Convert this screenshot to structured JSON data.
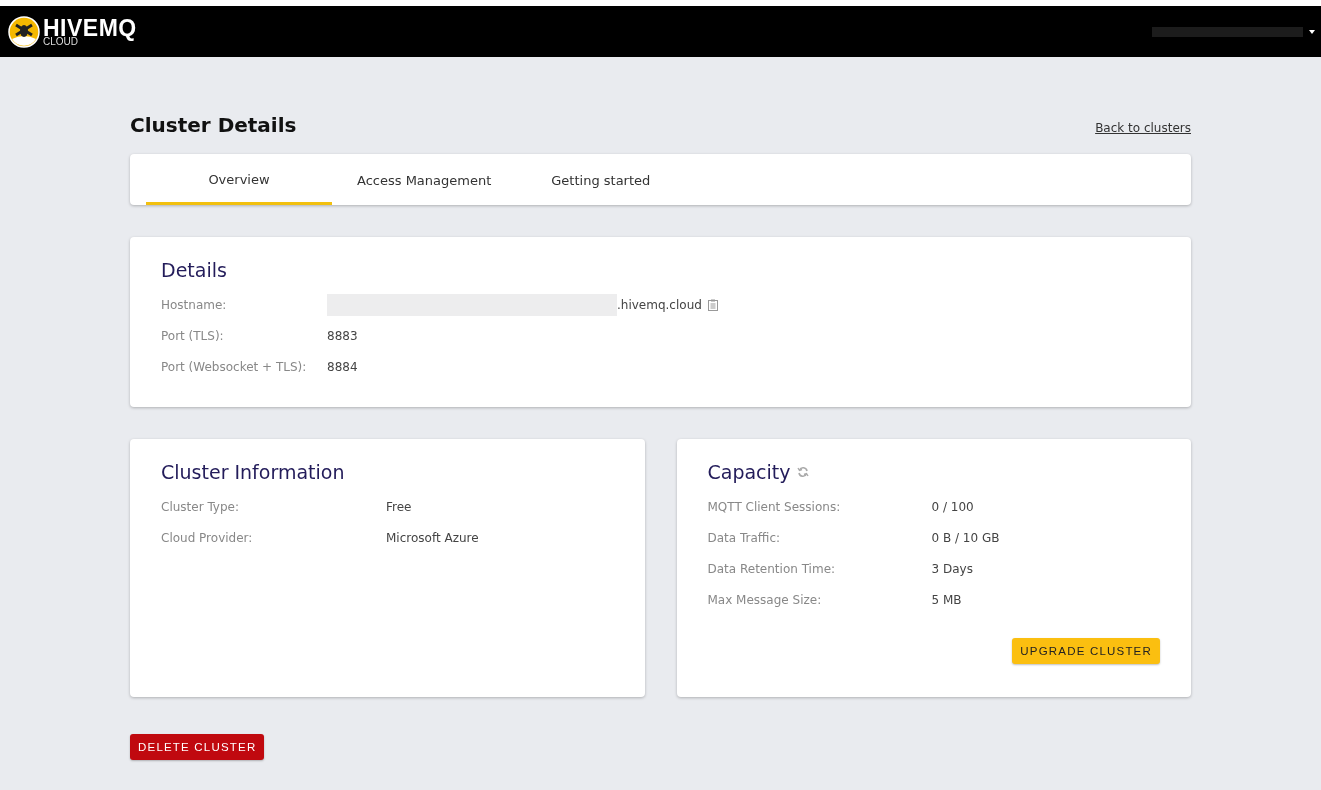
{
  "header": {
    "brand": "HIVEMQ",
    "brand_sub": "CLOUD"
  },
  "page": {
    "title": "Cluster Details",
    "back_link": "Back to clusters"
  },
  "tabs": [
    {
      "label": "Overview",
      "selected": true
    },
    {
      "label": "Access Management",
      "selected": false
    },
    {
      "label": "Getting started",
      "selected": false
    }
  ],
  "details": {
    "title": "Details",
    "rows": [
      {
        "label": "Hostname:",
        "value": ".hivemq.cloud",
        "kind": "host"
      },
      {
        "label": "Port (TLS):",
        "value": "8883",
        "kind": "plain"
      },
      {
        "label": "Port (Websocket + TLS):",
        "value": "8884",
        "kind": "plain"
      }
    ]
  },
  "cluster_information": {
    "title": "Cluster Information",
    "rows": [
      {
        "label": "Cluster Type:",
        "value": "Free"
      },
      {
        "label": "Cloud Provider:",
        "value": "Microsoft Azure"
      }
    ]
  },
  "capacity": {
    "title": "Capacity",
    "rows": [
      {
        "label": "MQTT Client Sessions:",
        "value": "0 / 100"
      },
      {
        "label": "Data Traffic:",
        "value": "0 B / 10 GB"
      },
      {
        "label": "Data Retention Time:",
        "value": "3 Days"
      },
      {
        "label": "Max Message Size:",
        "value": "5 MB"
      }
    ],
    "button": "UPGRADE CLUSTER"
  },
  "delete_button": "DELETE CLUSTER"
}
